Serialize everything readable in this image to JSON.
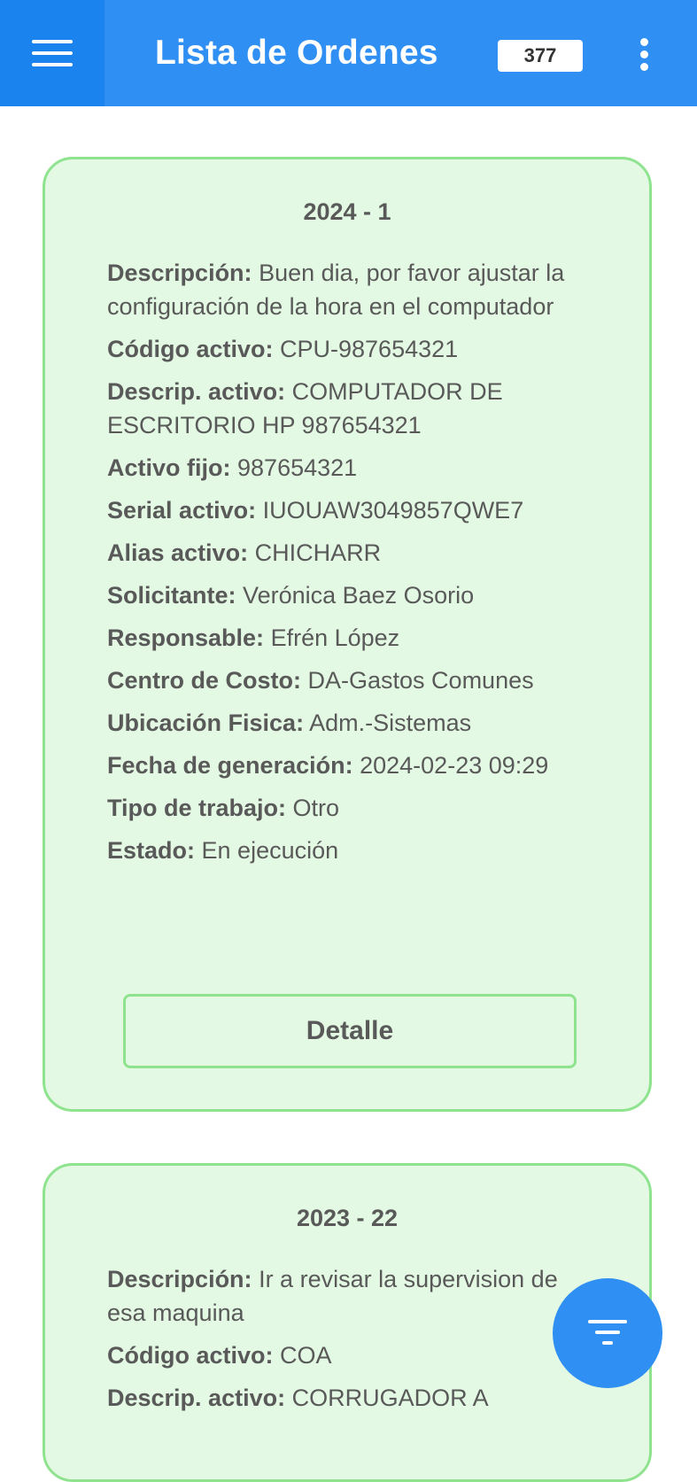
{
  "header": {
    "title": "Lista de Ordenes",
    "count": "377",
    "menu_icon": "hamburger-menu-icon",
    "more_icon": "more-vertical-icon",
    "color": "#2f8ff2"
  },
  "orders": [
    {
      "id": "2024 - 1",
      "fields": [
        {
          "label": "Descripción:",
          "value": "Buen dia, por favor ajustar la configuración de la hora en el computador"
        },
        {
          "label": "Código activo:",
          "value": "CPU-987654321"
        },
        {
          "label": "Descrip. activo:",
          "value": "COMPUTADOR DE ESCRITORIO HP 987654321"
        },
        {
          "label": "Activo fijo:",
          "value": "987654321"
        },
        {
          "label": "Serial activo:",
          "value": "IUOUAW3049857QWE7"
        },
        {
          "label": "Alias activo:",
          "value": "CHICHARR"
        },
        {
          "label": "Solicitante:",
          "value": "Verónica Baez Osorio"
        },
        {
          "label": "Responsable:",
          "value": "Efrén López"
        },
        {
          "label": "Centro de Costo:",
          "value": "DA-Gastos Comunes"
        },
        {
          "label": "Ubicación Fisica:",
          "value": "Adm.-Sistemas"
        },
        {
          "label": "Fecha de generación:",
          "value": "2024-02-23 09:29"
        },
        {
          "label": "Tipo de trabajo:",
          "value": "Otro"
        },
        {
          "label": "Estado:",
          "value": "En ejecución"
        }
      ],
      "button_label": "Detalle"
    },
    {
      "id": "2023 - 22",
      "fields": [
        {
          "label": "Descripción:",
          "value": "Ir a revisar la supervision de esa maquina"
        },
        {
          "label": "Código activo:",
          "value": "COA"
        },
        {
          "label": "Descrip. activo:",
          "value": "CORRUGADOR A"
        }
      ]
    }
  ],
  "fab": {
    "icon": "filter-icon",
    "color": "#2f8ff2"
  },
  "card_colors": {
    "background": "#e3f9e3",
    "border": "#8fe38f"
  }
}
